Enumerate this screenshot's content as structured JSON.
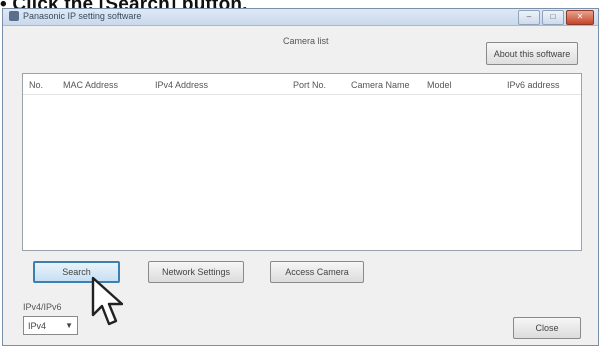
{
  "instruction": {
    "text": "• Click the [Search] button."
  },
  "window": {
    "title": "Panasonic IP setting software",
    "controls": {
      "minimize": "–",
      "maximize": "□",
      "close": "✕"
    }
  },
  "camera_ip_label": "Camera list",
  "about_button": "About this software",
  "table": {
    "columns": [
      "No.",
      "MAC Address",
      "IPv4 Address",
      "Port No.",
      "Camera Name",
      "Model",
      "IPv6 address"
    ],
    "rows": []
  },
  "buttons": {
    "search": "Search",
    "network_settings": "Network Settings",
    "access_camera": "Access Camera",
    "close": "Close"
  },
  "ip_version": {
    "label": "IPv4/IPv6",
    "selected": "IPv4"
  },
  "colors": {
    "accent": "#3c7fb1",
    "window_border": "#7a8fa8",
    "close_button": "#c4452b"
  },
  "icons": {
    "app": "app-icon",
    "cursor": "mouse-pointer-icon"
  }
}
